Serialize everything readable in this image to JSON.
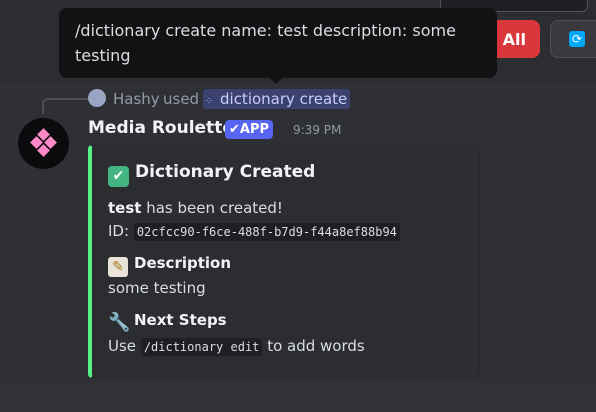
{
  "tooltip": {
    "text": "/dictionary create name: test description: some testing"
  },
  "top_buttons": {
    "red_label": "e All",
    "dark_icon": "refresh-icon"
  },
  "reply": {
    "user": "Hashy",
    "used": "used",
    "command": "dictionary create",
    "command_icon": "slash-command-icon"
  },
  "message": {
    "username": "Media Roulette",
    "badge": "APP",
    "timestamp": "9:39 PM"
  },
  "embed": {
    "accent_color": "#57f287",
    "title": "Dictionary Created",
    "created_name": "test",
    "created_suffix": " has been created!",
    "id_label": "ID:",
    "id_value": "02cfcc90-f6ce-488f-b7d9-f44a8ef88b94",
    "description_heading": "Description",
    "description_text": "some testing",
    "next_steps_heading": "Next Steps",
    "next_use": "Use",
    "next_command": "/dictionary edit",
    "next_suffix": "to add words"
  }
}
